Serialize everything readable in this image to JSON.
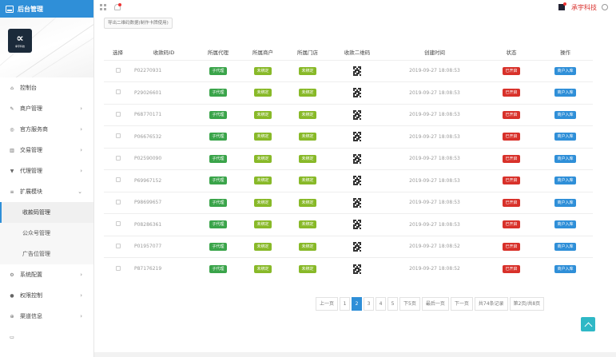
{
  "app": {
    "title": "后台管理",
    "company": "承宇科技",
    "logo_text": "承宇科技"
  },
  "sidebar": {
    "items": [
      {
        "label": "控制台",
        "icon": "home-icon",
        "has_arrow": false
      },
      {
        "label": "商户管理",
        "icon": "edit-icon",
        "has_arrow": true
      },
      {
        "label": "官方服务商",
        "icon": "eye-icon",
        "has_arrow": true
      },
      {
        "label": "交易管理",
        "icon": "chart-icon",
        "has_arrow": true
      },
      {
        "label": "代理管理",
        "icon": "shirt-icon",
        "has_arrow": true
      },
      {
        "label": "扩展模块",
        "icon": "list-icon",
        "has_arrow": true,
        "expanded": true
      }
    ],
    "subitems": [
      {
        "label": "收款码管理",
        "active": true
      },
      {
        "label": "公众号管理",
        "active": false
      },
      {
        "label": "广告位管理",
        "active": false
      }
    ],
    "bottom_items": [
      {
        "label": "系统配置",
        "icon": "gear-icon",
        "has_arrow": true
      },
      {
        "label": "权限控制",
        "icon": "lock-icon",
        "has_arrow": true
      },
      {
        "label": "渠道信息",
        "icon": "globe-icon",
        "has_arrow": true
      },
      {
        "label": "",
        "icon": "device-icon",
        "has_arrow": false
      }
    ]
  },
  "toolbar": {
    "export_label": "导出二维码数据(制作卡牌使用)"
  },
  "table": {
    "headers": [
      "选择",
      "收款码ID",
      "所属代理",
      "所属商户",
      "所属门店",
      "收款二维码",
      "创建时间",
      "状态",
      "操作"
    ],
    "rows": [
      {
        "id": "P02270931",
        "agent": "子代理",
        "merchant": "未绑定",
        "store": "未绑定",
        "created": "2019-09-27 18:08:53",
        "status": "已开启",
        "action": "商户入库"
      },
      {
        "id": "P29026601",
        "agent": "子代理",
        "merchant": "未绑定",
        "store": "未绑定",
        "created": "2019-09-27 18:08:53",
        "status": "已开启",
        "action": "商户入库"
      },
      {
        "id": "P68770171",
        "agent": "子代理",
        "merchant": "未绑定",
        "store": "未绑定",
        "created": "2019-09-27 18:08:53",
        "status": "已开启",
        "action": "商户入库"
      },
      {
        "id": "P06676532",
        "agent": "子代理",
        "merchant": "未绑定",
        "store": "未绑定",
        "created": "2019-09-27 18:08:53",
        "status": "已开启",
        "action": "商户入库"
      },
      {
        "id": "P02590090",
        "agent": "子代理",
        "merchant": "未绑定",
        "store": "未绑定",
        "created": "2019-09-27 18:08:53",
        "status": "已开启",
        "action": "商户入库"
      },
      {
        "id": "P69967152",
        "agent": "子代理",
        "merchant": "未绑定",
        "store": "未绑定",
        "created": "2019-09-27 18:08:53",
        "status": "已开启",
        "action": "商户入库"
      },
      {
        "id": "P98699657",
        "agent": "子代理",
        "merchant": "未绑定",
        "store": "未绑定",
        "created": "2019-09-27 18:08:53",
        "status": "已开启",
        "action": "商户入库"
      },
      {
        "id": "P08286361",
        "agent": "子代理",
        "merchant": "未绑定",
        "store": "未绑定",
        "created": "2019-09-27 18:08:53",
        "status": "已开启",
        "action": "商户入库"
      },
      {
        "id": "P01957077",
        "agent": "子代理",
        "merchant": "未绑定",
        "store": "未绑定",
        "created": "2019-09-27 18:08:52",
        "status": "已开启",
        "action": "商户入库"
      },
      {
        "id": "P87176219",
        "agent": "子代理",
        "merchant": "未绑定",
        "store": "未绑定",
        "created": "2019-09-27 18:08:52",
        "status": "已开启",
        "action": "商户入库"
      }
    ]
  },
  "pagination": {
    "prev": "上一页",
    "pages": [
      "1",
      "2",
      "3",
      "4",
      "5"
    ],
    "current": "2",
    "next5": "下5页",
    "last": "最后一页",
    "next": "下一页",
    "total": "共74条记录",
    "page_info": "第2页/共8页"
  },
  "colors": {
    "accent": "#2f8fd8",
    "agent_tag": "#3aa44a",
    "unbound_tag": "#88b928",
    "status_tag": "#d8312a",
    "action_tag": "#2f8fd8",
    "company": "#d9302c",
    "scroll_top": "#2fb8c6"
  }
}
